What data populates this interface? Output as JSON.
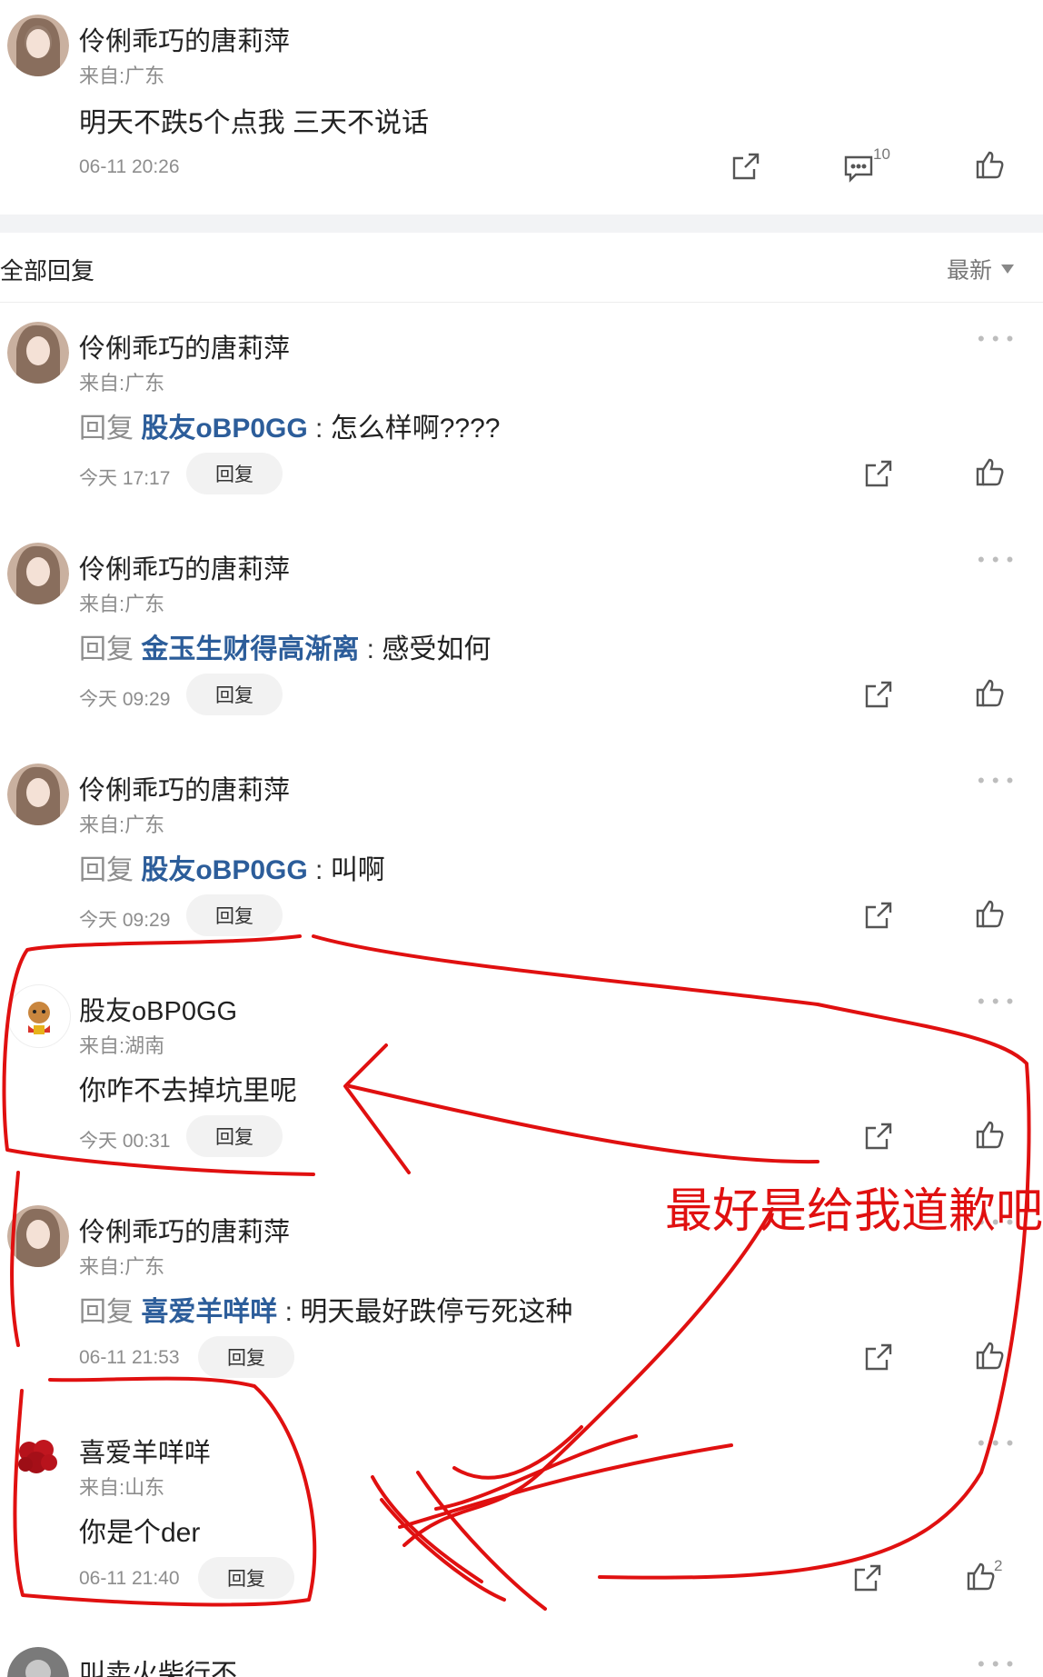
{
  "post": {
    "username": "伶俐乖巧的唐莉萍",
    "location": "来自:广东",
    "content": "明天不跌5个点我 三天不说话",
    "time": "06-11 20:26",
    "comment_count": "10",
    "icons": [
      "share-icon",
      "comment-icon",
      "like-icon"
    ]
  },
  "replies_header": {
    "title": "全部回复",
    "sort": "最新"
  },
  "replies": [
    {
      "username": "伶俐乖巧的唐莉萍",
      "location": "来自:广东",
      "prefix": "回复",
      "at": "股友oBP0GG",
      "sep": " : ",
      "text": "怎么样啊????",
      "time": "今天 17:17",
      "reply_label": "回复",
      "like_count": ""
    },
    {
      "username": "伶俐乖巧的唐莉萍",
      "location": "来自:广东",
      "prefix": "回复",
      "at": "金玉生财得高渐离",
      "sep": " : ",
      "text": "感受如何",
      "time": "今天 09:29",
      "reply_label": "回复",
      "like_count": ""
    },
    {
      "username": "伶俐乖巧的唐莉萍",
      "location": "来自:广东",
      "prefix": "回复",
      "at": "股友oBP0GG",
      "sep": " : ",
      "text": "叫啊",
      "time": "今天 09:29",
      "reply_label": "回复",
      "like_count": ""
    },
    {
      "username": "股友oBP0GG",
      "location": "来自:湖南",
      "prefix": "",
      "at": "",
      "sep": "",
      "text": "你咋不去掉坑里呢",
      "time": "今天 00:31",
      "reply_label": "回复",
      "like_count": ""
    },
    {
      "username": "伶俐乖巧的唐莉萍",
      "location": "来自:广东",
      "prefix": "回复",
      "at": "喜爱羊咩咩",
      "sep": " : ",
      "text": "明天最好跌停亏死这种",
      "time": "06-11 21:53",
      "reply_label": "回复",
      "like_count": ""
    },
    {
      "username": "喜爱羊咩咩",
      "location": "来自:山东",
      "prefix": "",
      "at": "",
      "sep": "",
      "text": "你是个der",
      "time": "06-11 21:40",
      "reply_label": "回复",
      "like_count": "2"
    },
    {
      "username": "叫卖火柴行不",
      "location": "",
      "prefix": "",
      "at": "",
      "sep": "",
      "text": "",
      "time": "",
      "reply_label": "",
      "like_count": ""
    }
  ],
  "annotation": {
    "text": "最好是给我道歉吧",
    "color": "#e01010"
  },
  "colors": {
    "link": "#2c5d9a",
    "muted": "#8d8d8d",
    "annotation": "#e01010"
  }
}
